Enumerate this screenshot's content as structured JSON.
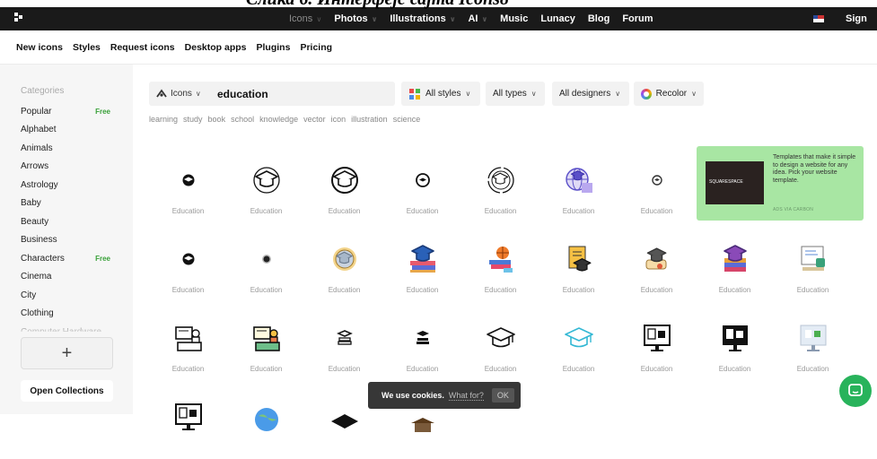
{
  "caption": "Слика 6. Интерфејс сајта Icons8",
  "topnav": [
    {
      "label": "Icons",
      "muted": true,
      "chevron": true
    },
    {
      "label": "Photos",
      "chevron": true
    },
    {
      "label": "Illustrations",
      "chevron": true
    },
    {
      "label": "AI",
      "chevron": true
    },
    {
      "label": "Music"
    },
    {
      "label": "Lunacy"
    },
    {
      "label": "Blog"
    },
    {
      "label": "Forum"
    }
  ],
  "signin": "Sign in",
  "subnav": [
    "New icons",
    "Styles",
    "Request icons",
    "Desktop apps",
    "Plugins",
    "Pricing"
  ],
  "sidebar": {
    "title": "Categories",
    "categories": [
      {
        "label": "Popular",
        "badge": "Free"
      },
      {
        "label": "Alphabet"
      },
      {
        "label": "Animals"
      },
      {
        "label": "Arrows"
      },
      {
        "label": "Astrology"
      },
      {
        "label": "Baby"
      },
      {
        "label": "Beauty"
      },
      {
        "label": "Business"
      },
      {
        "label": "Characters",
        "badge": "Free"
      },
      {
        "label": "Cinema"
      },
      {
        "label": "City"
      },
      {
        "label": "Clothing"
      },
      {
        "label": "Computer Hardware"
      }
    ],
    "add_symbol": "+",
    "open_collections": "Open Collections"
  },
  "search": {
    "type_label": "Icons",
    "query": "education"
  },
  "filters": {
    "styles": "All styles",
    "types": "All types",
    "designers": "All designers",
    "recolor": "Recolor"
  },
  "tags": [
    "learning",
    "study",
    "book",
    "school",
    "knowledge",
    "vector",
    "icon",
    "illustration",
    "science"
  ],
  "ad": {
    "text": "Templates that make it simple to design a website for any idea. Pick your website template.",
    "via": "ADS VIA CARBON",
    "brand": "SQUARESPACE"
  },
  "icon_label": "Education",
  "icons": [
    {
      "icon": "cap-solid-small"
    },
    {
      "icon": "cap-outline-circle"
    },
    {
      "icon": "cap-outline-circle-bold"
    },
    {
      "icon": "cap-circle-small"
    },
    {
      "icon": "cap-dashed-circle"
    },
    {
      "icon": "globe-cap-color"
    },
    {
      "icon": "cap-circle-tiny"
    },
    {
      "icon": "cap-solid-small"
    },
    {
      "icon": "cap-circle-dark"
    },
    {
      "icon": "cap-gold-circle"
    },
    {
      "icon": "books-cap-color"
    },
    {
      "icon": "basketball-books"
    },
    {
      "icon": "diploma-cap"
    },
    {
      "icon": "scroll-cap"
    },
    {
      "icon": "books-stack-cap"
    },
    {
      "icon": "board-cup"
    },
    {
      "icon": "desk-teacher"
    },
    {
      "icon": "desk-teacher-color"
    },
    {
      "icon": "cap-books-line"
    },
    {
      "icon": "cap-books-solid"
    },
    {
      "icon": "mortarboard-outline"
    },
    {
      "icon": "mortarboard-teal"
    },
    {
      "icon": "monitor-doc"
    },
    {
      "icon": "monitor-doc-dark"
    },
    {
      "icon": "monitor-doc-light"
    },
    {
      "icon": "monitor-doc"
    },
    {
      "icon": "globe-blue"
    },
    {
      "icon": "mortarboard-black"
    },
    {
      "icon": "cap-brown"
    }
  ],
  "cookie": {
    "text": "We use cookies.",
    "link": "What for?",
    "ok": "OK"
  },
  "colors": {
    "topbar": "#1a1a1a",
    "ad_bg": "#a8e6a3",
    "chat": "#28b35b"
  }
}
